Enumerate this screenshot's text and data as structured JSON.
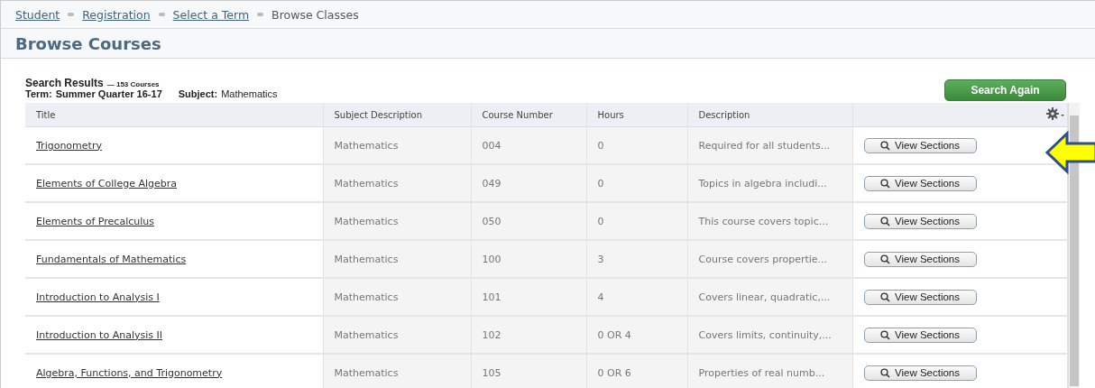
{
  "breadcrumb": [
    {
      "label": "Student",
      "link": true
    },
    {
      "label": "Registration",
      "link": true
    },
    {
      "label": "Select a Term",
      "link": true
    },
    {
      "label": "Browse Classes",
      "link": false
    }
  ],
  "page_title": "Browse Courses",
  "results": {
    "heading": "Search Results",
    "count": "— 153 Courses",
    "term_label": "Term:",
    "term": "Summer Quarter 16-17",
    "subject_label": "Subject:",
    "subject": "Mathematics"
  },
  "search_again": "Search Again",
  "table": {
    "columns": [
      "Title",
      "Subject Description",
      "Course Number",
      "Hours",
      "Description"
    ],
    "rows": [
      {
        "title": "Trigonometry",
        "subject": "Mathematics",
        "number": "004",
        "hours": "0",
        "description": "Required for all students...",
        "action": "View Sections"
      },
      {
        "title": "Elements of College Algebra",
        "subject": "Mathematics",
        "number": "049",
        "hours": "0",
        "description": "Topics in algebra includi...",
        "action": "View Sections"
      },
      {
        "title": "Elements of Precalculus",
        "subject": "Mathematics",
        "number": "050",
        "hours": "0",
        "description": "This course covers topic...",
        "action": "View Sections"
      },
      {
        "title": "Fundamentals of Mathematics",
        "subject": "Mathematics",
        "number": "100",
        "hours": "3",
        "description": "Course covers propertie...",
        "action": "View Sections"
      },
      {
        "title": "Introduction to Analysis I",
        "subject": "Mathematics",
        "number": "101",
        "hours": "4",
        "description": "Covers linear, quadratic,...",
        "action": "View Sections"
      },
      {
        "title": "Introduction to Analysis II",
        "subject": "Mathematics",
        "number": "102",
        "hours": "0 OR 4",
        "description": "Covers limits, continuity,...",
        "action": "View Sections"
      },
      {
        "title": "Algebra, Functions, and Trigonometry",
        "subject": "Mathematics",
        "number": "105",
        "hours": "0 OR 6",
        "description": "Properties of real numb...",
        "action": "View Sections"
      }
    ]
  }
}
